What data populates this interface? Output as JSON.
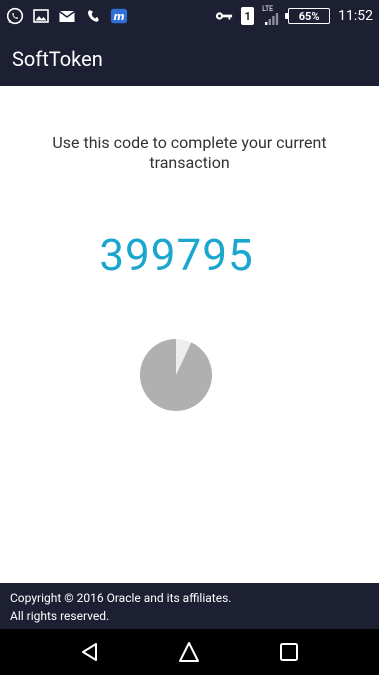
{
  "status_bar": {
    "sim_slot": "1",
    "network": "LTE",
    "battery": "65%",
    "time": "11:52",
    "icons": [
      "whatsapp-icon",
      "gallery-icon",
      "mail-icon",
      "missed-call-icon",
      "m-app-icon",
      "vpn-key-icon",
      "signal-icon"
    ]
  },
  "app_bar": {
    "title": "SoftToken"
  },
  "main": {
    "instruction": "Use this code to complete your current transaction",
    "code": "399795",
    "timer_progress": 0.93
  },
  "footer": {
    "copyright": "Copyright © 2016 Oracle and its affiliates.",
    "rights": "All rights reserved."
  },
  "nav_bar": {
    "buttons": [
      "back-icon",
      "home-icon",
      "recents-icon"
    ]
  },
  "colors": {
    "bar_background": "#1d1f33",
    "code_color": "#1aa6cd",
    "timer_fill": "#b0b0b0",
    "timer_remaining": "#eeeeee"
  }
}
